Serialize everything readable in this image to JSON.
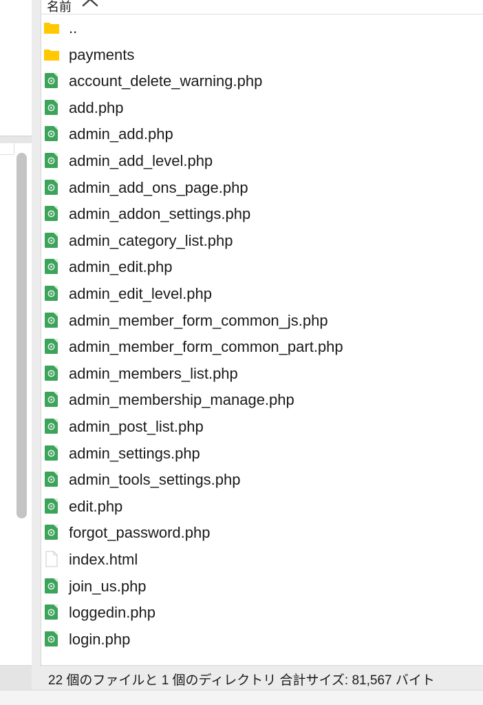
{
  "remote_panel": {
    "column_header": "名前",
    "sort_direction": "ascending",
    "entries": [
      {
        "name": "..",
        "type": "folder",
        "icon": "folder-icon"
      },
      {
        "name": "payments",
        "type": "folder",
        "icon": "folder-icon"
      },
      {
        "name": "account_delete_warning.php",
        "type": "php",
        "icon": "php-file-icon"
      },
      {
        "name": "add.php",
        "type": "php",
        "icon": "php-file-icon"
      },
      {
        "name": "admin_add.php",
        "type": "php",
        "icon": "php-file-icon"
      },
      {
        "name": "admin_add_level.php",
        "type": "php",
        "icon": "php-file-icon"
      },
      {
        "name": "admin_add_ons_page.php",
        "type": "php",
        "icon": "php-file-icon"
      },
      {
        "name": "admin_addon_settings.php",
        "type": "php",
        "icon": "php-file-icon"
      },
      {
        "name": "admin_category_list.php",
        "type": "php",
        "icon": "php-file-icon"
      },
      {
        "name": "admin_edit.php",
        "type": "php",
        "icon": "php-file-icon"
      },
      {
        "name": "admin_edit_level.php",
        "type": "php",
        "icon": "php-file-icon"
      },
      {
        "name": "admin_member_form_common_js.php",
        "type": "php",
        "icon": "php-file-icon"
      },
      {
        "name": "admin_member_form_common_part.php",
        "type": "php",
        "icon": "php-file-icon"
      },
      {
        "name": "admin_members_list.php",
        "type": "php",
        "icon": "php-file-icon"
      },
      {
        "name": "admin_membership_manage.php",
        "type": "php",
        "icon": "php-file-icon"
      },
      {
        "name": "admin_post_list.php",
        "type": "php",
        "icon": "php-file-icon"
      },
      {
        "name": "admin_settings.php",
        "type": "php",
        "icon": "php-file-icon"
      },
      {
        "name": "admin_tools_settings.php",
        "type": "php",
        "icon": "php-file-icon"
      },
      {
        "name": "edit.php",
        "type": "php",
        "icon": "php-file-icon"
      },
      {
        "name": "forgot_password.php",
        "type": "php",
        "icon": "php-file-icon"
      },
      {
        "name": "index.html",
        "type": "html",
        "icon": "blank-file-icon"
      },
      {
        "name": "join_us.php",
        "type": "php",
        "icon": "php-file-icon"
      },
      {
        "name": "loggedin.php",
        "type": "php",
        "icon": "php-file-icon"
      },
      {
        "name": "login.php",
        "type": "php",
        "icon": "php-file-icon"
      }
    ],
    "status_text": "22 個のファイルと 1 個のディレクトリ 合計サイズ: 81,567 バイト"
  },
  "colors": {
    "folder": "#ffc800",
    "php_icon": "#3ca35a",
    "panel_background": "#ffffff",
    "chrome_background": "#ececec"
  }
}
